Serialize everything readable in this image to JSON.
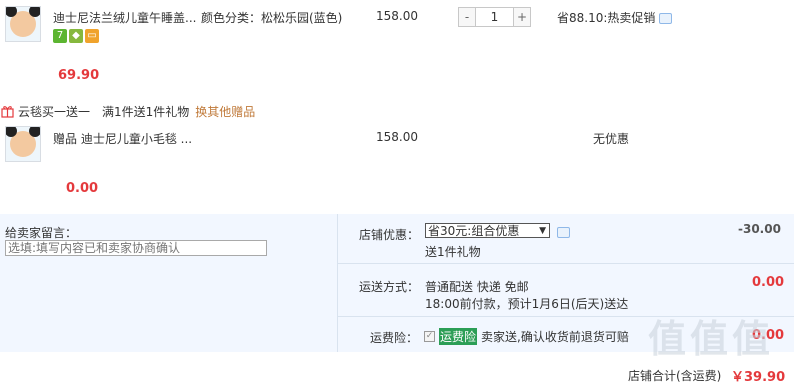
{
  "item1": {
    "title": "迪士尼法兰绒儿童午睡盖...",
    "variant": "颜色分类：松松乐园(蓝色)",
    "unit_price": "158.00",
    "quantity": "1",
    "minus": "-",
    "plus": "+",
    "promo": "省88.10:热卖促销",
    "subtotal": "69.90",
    "badge_7": "7"
  },
  "gift_bar": {
    "label": "云毯买一送一",
    "rule": "满1件送1件礼物",
    "change_link": "换其他赠品"
  },
  "item2": {
    "title": "赠品 迪士尼儿童小毛毯 ...",
    "unit_price": "158.00",
    "promo": "无优惠",
    "subtotal": "0.00"
  },
  "message": {
    "label": "给卖家留言：",
    "placeholder": "选填:填写内容已和卖家协商确认"
  },
  "shop_discount": {
    "label": "店铺优惠：",
    "selected": "省30元:组合优惠",
    "sub": "送1件礼物",
    "amount": "-30.00"
  },
  "shipping": {
    "label": "运送方式：",
    "method": "普通配送 快递 免邮",
    "eta": "18:00前付款，预计1月6日(后天)送达",
    "amount": "0.00"
  },
  "insurance": {
    "label": "运费险：",
    "tag": "运费险",
    "desc": "卖家送,确认收货前退货可赔",
    "amount": "0.00"
  },
  "total": {
    "label": "店铺合计(含运费)",
    "amount": "￥39.90"
  },
  "colors": {
    "price_red": "#e4393c",
    "link_orange": "#c07a3a",
    "panel_bg": "#f2f7ff",
    "insurance_green": "#2c9e56"
  },
  "watermark": "值值值"
}
